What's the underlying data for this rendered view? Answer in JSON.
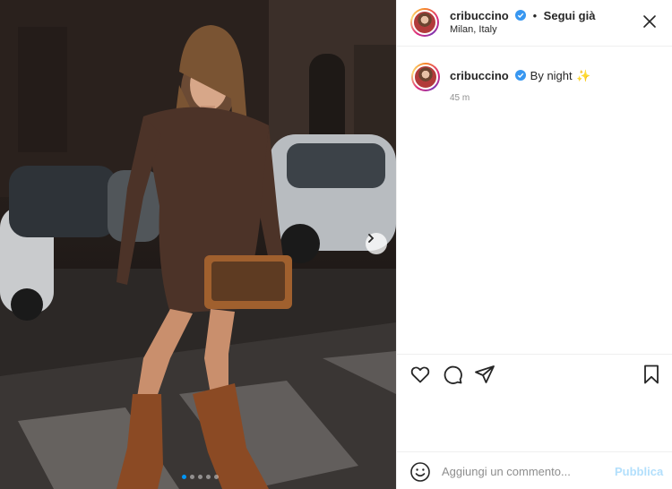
{
  "post": {
    "username": "cribuccino",
    "follow_separator": "•",
    "follow_label": "Segui già",
    "location": "Milan, Italy",
    "caption": "By night",
    "caption_emoji": "✨",
    "time_ago": "45 m",
    "carousel": {
      "slides": 5,
      "active_index": 0
    }
  },
  "comment_bar": {
    "placeholder": "Aggiungi un commento...",
    "publish_label": "Pubblica"
  },
  "icons": {
    "verified": "verified-badge-icon",
    "more": "more-options-icon",
    "like": "heart-icon",
    "comment": "comment-bubble-icon",
    "share": "paper-plane-icon",
    "save": "bookmark-icon",
    "emoji": "smiley-icon",
    "next": "chevron-right-icon"
  },
  "colors": {
    "verified_blue": "#3897f0",
    "active_dot": "#0095f6",
    "publish_disabled": "#b2dffc",
    "secondary_text": "#8e8e8e"
  }
}
